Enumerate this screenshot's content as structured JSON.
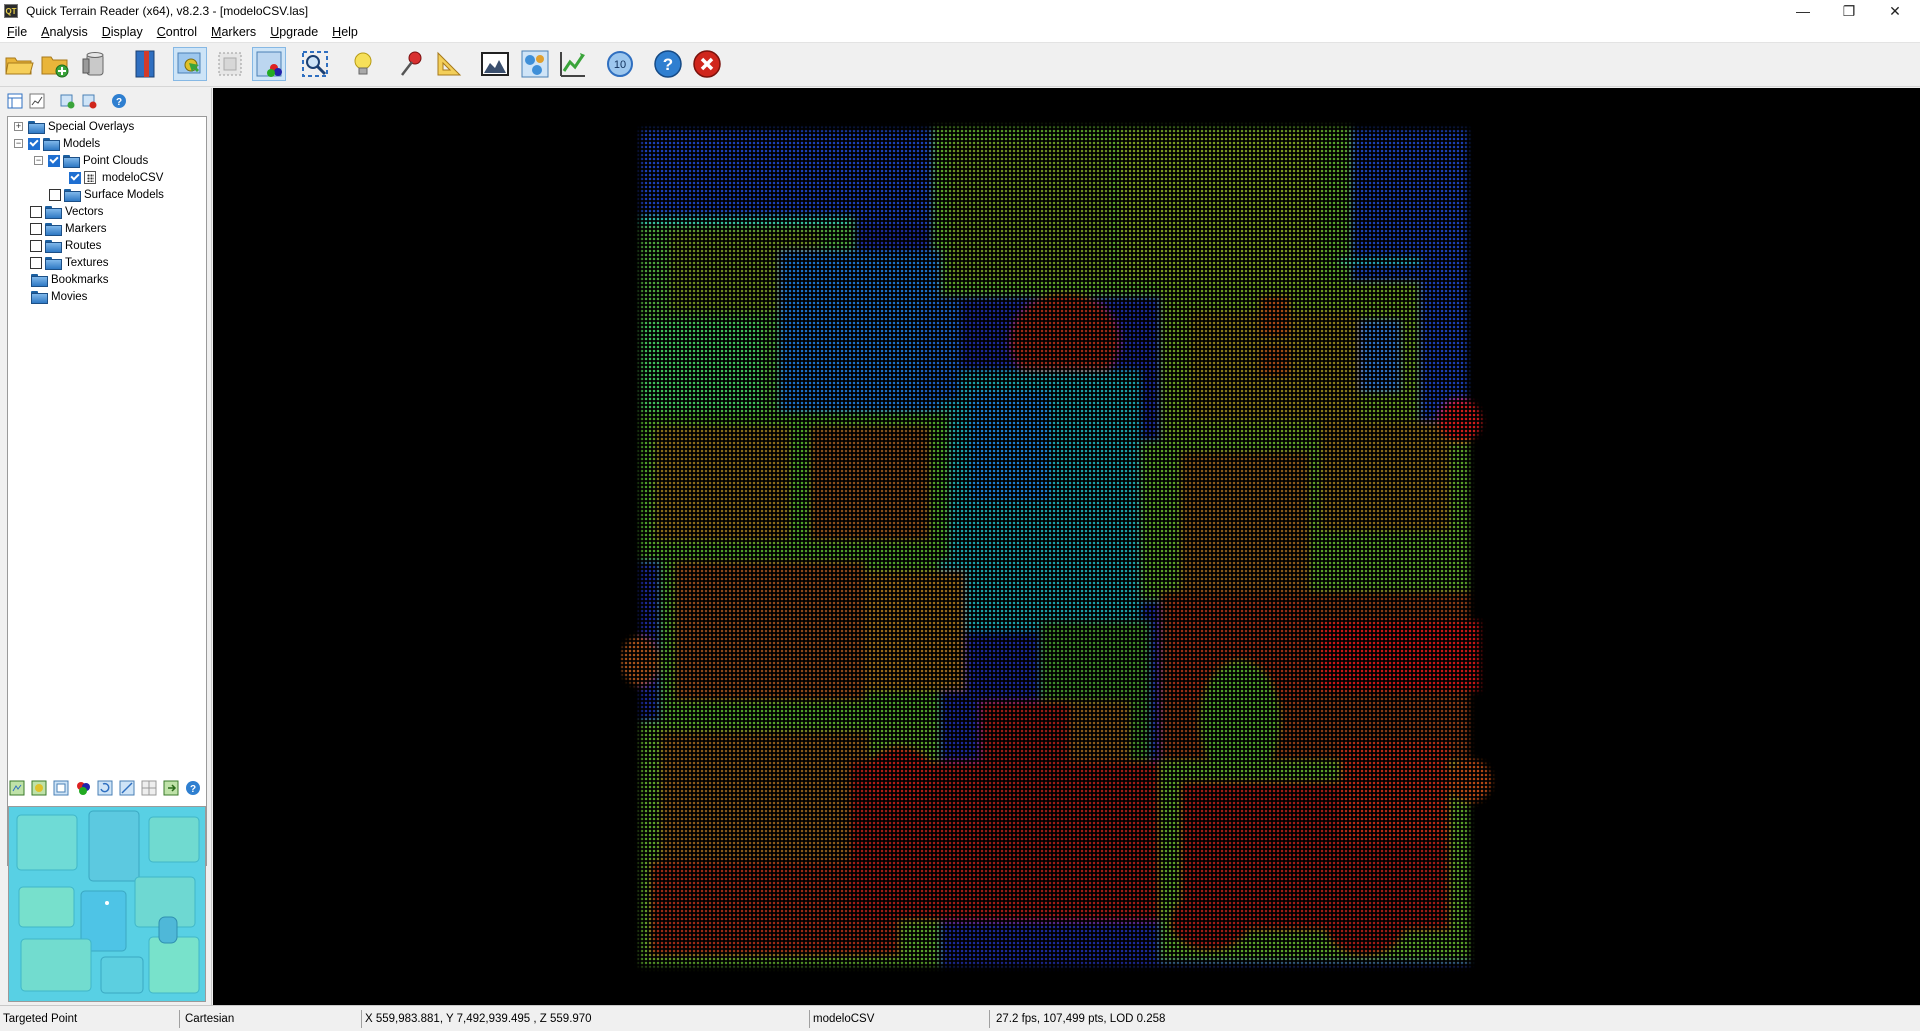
{
  "window": {
    "app_icon_text": "QT",
    "title": "Quick Terrain Reader (x64), v8.2.3 - [modeloCSV.las]",
    "minimize": "—",
    "maximize": "❐",
    "close": "✕"
  },
  "menu": [
    {
      "first": "F",
      "rest": "ile"
    },
    {
      "first": "A",
      "rest": "nalysis"
    },
    {
      "first": "D",
      "rest": "isplay"
    },
    {
      "first": "C",
      "rest": "ontrol"
    },
    {
      "first": "M",
      "rest": "arkers"
    },
    {
      "first": "U",
      "rest": "pgrade"
    },
    {
      "first": "H",
      "rest": "elp"
    }
  ],
  "toolbar": {
    "icons": [
      "open-folder-icon",
      "add-model-icon",
      "database-icon",
      "bookmark-icon",
      "navigate-mode-icon",
      "select-mode-icon",
      "color-mode-icon",
      "zoom-extents-icon",
      "light-icon",
      "marker-pin-icon",
      "measure-icon",
      "profile-icon",
      "spheres-icon",
      "graph-icon",
      "level-icon",
      "help-icon",
      "exit-icon"
    ],
    "level_text": "10",
    "help_text": "?",
    "accent_blue": "#2f7fd0",
    "exit_red": "#d0261c"
  },
  "tree": {
    "items": [
      {
        "label": "Special Overlays",
        "expander": "+",
        "checked": null
      },
      {
        "label": "Models",
        "expander": "−",
        "checked": true
      },
      {
        "label": "Point Clouds",
        "expander": "−",
        "checked": true
      },
      {
        "label": "modeloCSV",
        "expander": null,
        "checked": true
      },
      {
        "label": "Surface Models",
        "expander": null,
        "checked": false
      },
      {
        "label": "Vectors",
        "expander": null,
        "checked": false
      },
      {
        "label": "Markers",
        "expander": null,
        "checked": false
      },
      {
        "label": "Routes",
        "expander": null,
        "checked": false
      },
      {
        "label": "Textures",
        "expander": null,
        "checked": false
      },
      {
        "label": "Bookmarks",
        "expander": null,
        "checked": null
      },
      {
        "label": "Movies",
        "expander": null,
        "checked": null
      }
    ]
  },
  "viewport": {
    "background": "#000000",
    "color_ramp": [
      "#1a2a9a",
      "#1b7fd8",
      "#1fc0a8",
      "#3fae3a",
      "#8fbf22",
      "#c9a21a",
      "#b8521a",
      "#a01d12",
      "#d11a1a"
    ]
  },
  "status": {
    "mode": "Targeted Point",
    "coords_system": "Cartesian",
    "position": "X 559,983.881, Y 7,492,939.495 , Z 559.970",
    "model": "modeloCSV",
    "perf": "27.2 fps, 107,499 pts, LOD 0.258"
  }
}
